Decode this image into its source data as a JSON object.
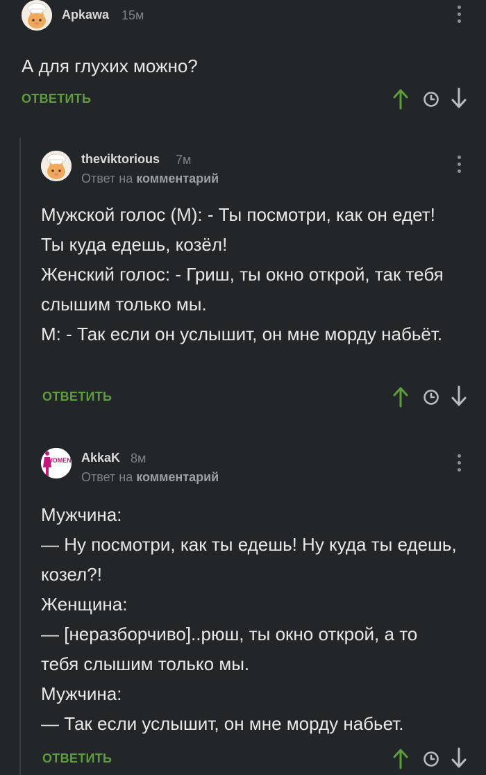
{
  "comments": [
    {
      "username": "Apkawa",
      "time": "15м",
      "body": [
        "А для глухих можно?"
      ],
      "reply_label": "ОТВЕТИТЬ"
    },
    {
      "username": "theviktorious",
      "time": "7м",
      "reply_prefix": "Ответ на",
      "reply_target": "комментарий",
      "body": [
        "Мужской голос (М): - Ты посмотри, как он едет! Ты куда едешь, козёл!",
        "Женский голос: - Гриш, ты окно открой, так тебя слышим только мы.",
        "М: - Так если он услышит, он мне морду набьёт."
      ],
      "reply_label": "ОТВЕТИТЬ"
    },
    {
      "username": "AkkaK",
      "time": "8м",
      "avatar_text": "WOMEN",
      "reply_prefix": "Ответ на",
      "reply_target": "комментарий",
      "body": [
        "Мужчина:",
        "— Ну посмотри, как ты едешь! Ну куда ты едешь, козел?!",
        "Женщина:",
        "— [неразборчиво]..рюш, ты окно открой, а то тебя слышим только мы.",
        "Мужчина:",
        "— Так если услышит, он мне морду набьет."
      ],
      "reply_label": "ОТВЕТИТЬ"
    }
  ],
  "colors": {
    "background": "#232629",
    "accent_green": "#5e9d3b",
    "muted": "#7d8286",
    "thread_line": "#3a3e42"
  },
  "icons": [
    "upvote-icon",
    "clock-icon",
    "downvote-icon",
    "more-vertical-icon"
  ]
}
